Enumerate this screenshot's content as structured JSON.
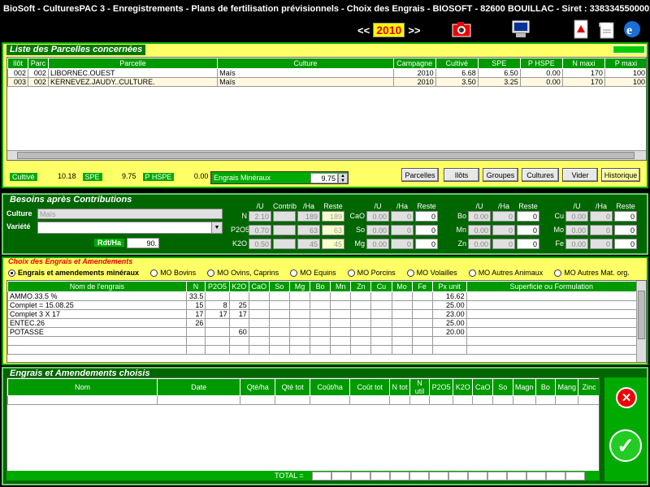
{
  "window": {
    "title": "BioSoft - CulturesPAC 3 - Enregistrements - Plans de fertilisation prévisionnels - Choix des Engrais   - BIOSOFT - 82600 BOUILLAC - Siret : 3383345500001..."
  },
  "toolbar": {
    "prev": "<<",
    "year": "2010",
    "next": ">>"
  },
  "parcelles": {
    "legend": "Liste des Parcelles concernées",
    "headers": [
      "Ilôt",
      "Parc",
      "Parcelle",
      "Culture",
      "Campagne",
      "Cultivé",
      "SPE",
      "P HSPE",
      "N maxi",
      "P maxi"
    ],
    "rows": [
      [
        "002",
        "002",
        "LIBORNEC.OUEST",
        "Maïs",
        "2010",
        "6.68",
        "6.50",
        "0.00",
        "170",
        "100"
      ],
      [
        "003",
        "002",
        "KERNEVEZ.JAUDY..CULTURE.",
        "Maïs",
        "2010",
        "3.50",
        "3.25",
        "0.00",
        "170",
        "100"
      ]
    ],
    "summary": {
      "cultive_label": "Cultivé",
      "cultive": "10.18",
      "spe_label": "SPE",
      "spe": "9.75",
      "phspe_label": "P HSPE",
      "phspe": "0.00",
      "engrais_label": "Engrais Minéraux",
      "engrais": "9.75"
    },
    "buttons": {
      "parcelles": "Parcelles",
      "ilots": "Ilôts",
      "groupes": "Groupes",
      "cultures": "Cultures",
      "vider": "Vider",
      "historique": "Historique"
    }
  },
  "besoins": {
    "legend": "Besoins après Contributions",
    "culture_label": "Culture",
    "culture": "Maïs",
    "variete_label": "Variété",
    "rdt_label": "Rdt/Ha",
    "rdt": "90.",
    "col_headers": {
      "u": "/U",
      "contrib": "Contrib",
      "ha": "/Ha",
      "reste": "Reste"
    },
    "left": [
      {
        "el": "N",
        "u": "2.10",
        "contrib": "",
        "ha": "189",
        "reste": "189"
      },
      {
        "el": "P2O5",
        "u": "0.70",
        "contrib": "",
        "ha": "63",
        "reste": "63"
      },
      {
        "el": "K2O",
        "u": "0.50",
        "contrib": "",
        "ha": "45",
        "reste": "45"
      }
    ],
    "mid": [
      {
        "el": "CaO",
        "u": "0.00",
        "ha": "0",
        "reste": "0"
      },
      {
        "el": "So",
        "u": "0.00",
        "ha": "0",
        "reste": "0"
      },
      {
        "el": "Mg",
        "u": "0.00",
        "ha": "0",
        "reste": "0"
      }
    ],
    "r1": [
      {
        "el": "Bo",
        "u": "0.00",
        "ha": "0",
        "reste": "0"
      },
      {
        "el": "Mn",
        "u": "0.00",
        "ha": "0",
        "reste": "0"
      },
      {
        "el": "Zn",
        "u": "0.00",
        "ha": "0",
        "reste": "0"
      }
    ],
    "r2": [
      {
        "el": "Cu",
        "u": "0.00",
        "ha": "0",
        "reste": "0"
      },
      {
        "el": "Mo",
        "u": "0.00",
        "ha": "0",
        "reste": "0"
      },
      {
        "el": "Fe",
        "u": "0.00",
        "ha": "0",
        "reste": "0"
      }
    ]
  },
  "choix": {
    "legend": "Choix des Engrais et Amendements",
    "radios": [
      "Engrais et amendements minéraux",
      "MO Bovins",
      "MO Ovins, Caprins",
      "MO Equins",
      "MO Porcins",
      "MO Volailles",
      "MO Autres Animaux",
      "MO Autres Mat. org."
    ],
    "headers": [
      "Nom de l'engrais",
      "N",
      "P2O5",
      "K2O",
      "CaO",
      "So",
      "Mg",
      "Bo",
      "Mn",
      "Zn",
      "Cu",
      "Mo",
      "Fe",
      "Px unit",
      "Superficie ou Formulation"
    ],
    "rows": [
      [
        "AMMO.33.5 %",
        "33.5",
        "",
        "",
        "",
        "",
        "",
        "",
        "",
        "",
        "",
        "",
        "",
        "16.62",
        ""
      ],
      [
        "Complet = 15.08.25",
        "15",
        "8",
        "25",
        "",
        "",
        "",
        "",
        "",
        "",
        "",
        "",
        "",
        "25.00",
        ""
      ],
      [
        "Complet 3 X 17",
        "17",
        "17",
        "17",
        "",
        "",
        "",
        "",
        "",
        "",
        "",
        "",
        "",
        "23.00",
        ""
      ],
      [
        "ENTEC.26",
        "26",
        "",
        "",
        "",
        "",
        "",
        "",
        "",
        "",
        "",
        "",
        "",
        "25.00",
        ""
      ],
      [
        "POTASSE",
        "",
        "",
        "60",
        "",
        "",
        "",
        "",
        "",
        "",
        "",
        "",
        "",
        "20.00",
        ""
      ]
    ]
  },
  "choisis": {
    "legend": "Engrais et Amendements choisis",
    "headers": [
      "Nom",
      "Date",
      "Qté/ha",
      "Qté tot",
      "Coût/ha",
      "Coût tot",
      "N tot",
      "N util",
      "P2O5",
      "K2O",
      "CaO",
      "So",
      "Magn",
      "Bo",
      "Mang",
      "Zinc"
    ],
    "total_label": "TOTAL ="
  },
  "colors": {
    "panel_bg": "#ffff66",
    "panel_border": "#00aa00",
    "dark_green": "#006600",
    "header_green": "#009900"
  }
}
